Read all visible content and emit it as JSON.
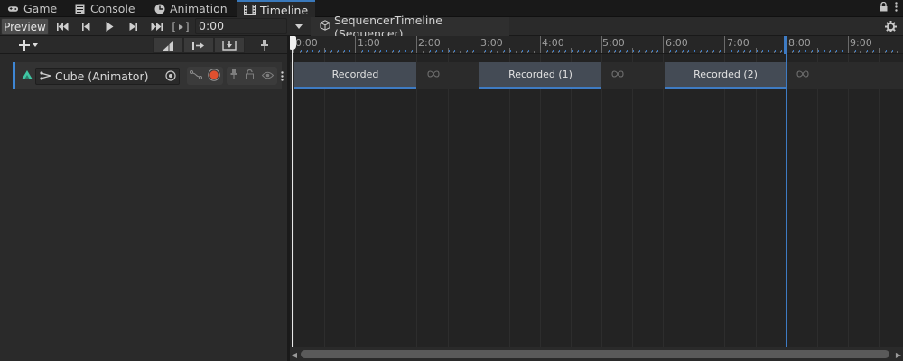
{
  "tabs": [
    {
      "label": "Game",
      "icon": "gamepad-icon"
    },
    {
      "label": "Console",
      "icon": "console-icon"
    },
    {
      "label": "Animation",
      "icon": "animation-clock-icon"
    },
    {
      "label": "Timeline",
      "icon": "film-strip-icon",
      "active": true
    }
  ],
  "toolbar": {
    "preview_label": "Preview",
    "time_value": "0:00",
    "breadcrumb": "SequencerTimeline (Sequencer)"
  },
  "track": {
    "binding_label": "Cube (Animator)"
  },
  "ruler": {
    "labels": [
      "0:00",
      "1:00",
      "2:00",
      "3:00",
      "4:00",
      "5:00",
      "6:00",
      "7:00",
      "8:00",
      "9:00"
    ]
  },
  "clips": [
    {
      "label": "Recorded"
    },
    {
      "label": "Recorded (1)"
    },
    {
      "label": "Recorded (2)"
    }
  ],
  "colors": {
    "accent": "#3e7bc3",
    "record": "#e0502f",
    "track_color": "#3fc6a3"
  }
}
